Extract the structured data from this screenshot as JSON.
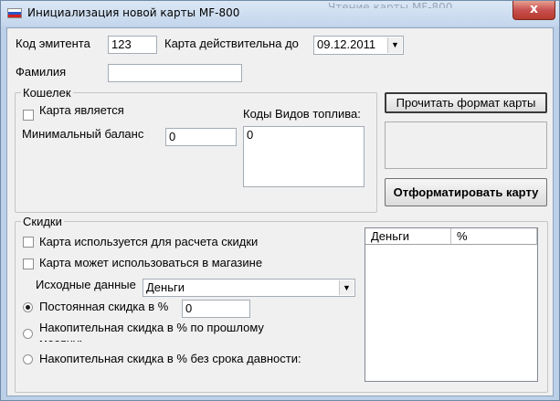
{
  "window": {
    "title": "Инициализация новой карты MF-800",
    "background_title": "Чтение карты MF-800",
    "close_label": "x",
    "flag_colors": [
      "#ffffff",
      "#2a55c8",
      "#d42020"
    ]
  },
  "top": {
    "issuer_code_label": "Код эмитента",
    "issuer_code_value": "123",
    "card_valid_label": "Карта действительна до",
    "card_valid_value": "09.12.2011",
    "surname_label": "Фамилия",
    "surname_value": ""
  },
  "wallet": {
    "legend": "Кошелек",
    "is_wallet_label": "Карта является кошельком",
    "is_wallet_checked": false,
    "min_balance_label": "Минимальный баланс",
    "min_balance_value": "0",
    "fuel_codes_label": "Коды Видов топлива:",
    "fuel_codes_value": "0"
  },
  "actions": {
    "read_format_label": "Прочитать формат карты",
    "format_label": "Отформатировать карту"
  },
  "discounts": {
    "legend": "Скидки",
    "used_for_discount_label": "Карта используется для расчета скидки",
    "used_for_discount_checked": false,
    "used_in_store_label": "Карта может использоваться в магазине",
    "used_in_store_checked": false,
    "source_data_label": "Исходные данные",
    "source_data_value": "Деньги",
    "constant_label": "Постоянная скидка в %",
    "constant_value": "0",
    "constant_selected": true,
    "cumulative_prev_label": "Накопительная скидка в % по прошлому месяцу:",
    "cumulative_nolimit_label": "Накопительная скидка в %  без срока давности:",
    "table_columns": [
      "Деньги",
      "%"
    ]
  }
}
